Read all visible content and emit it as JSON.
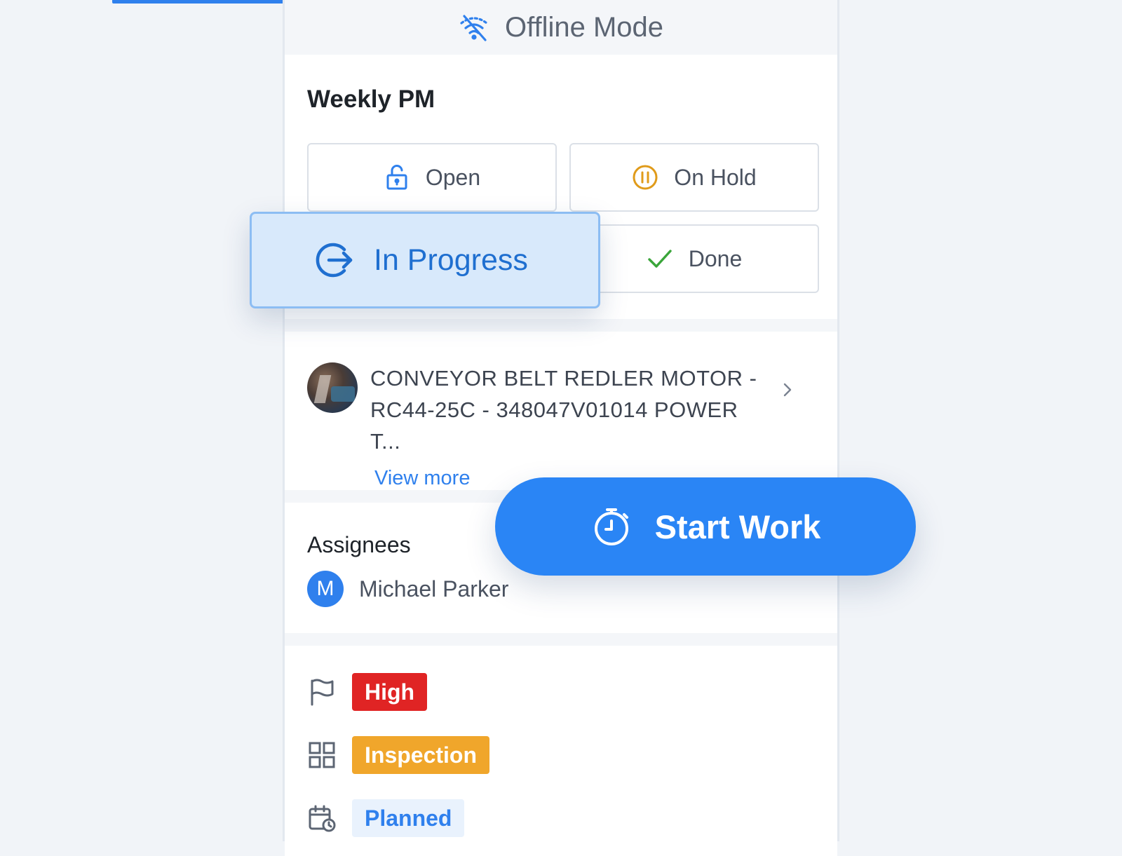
{
  "progress": {
    "fraction": 0.5
  },
  "header": {
    "offline_label": "Offline Mode",
    "icon": "wifi-off-icon"
  },
  "work_order": {
    "title": "Weekly PM",
    "statuses": [
      {
        "label": "Open",
        "icon": "unlock-icon",
        "color": "#2f80ed"
      },
      {
        "label": "On Hold",
        "icon": "pause-circle-icon",
        "color": "#e09b1a"
      },
      {
        "label": "In Progress",
        "icon": "progress-arrow-icon",
        "color": "#1f6fd0",
        "selected": true
      },
      {
        "label": "Done",
        "icon": "checkmark-icon",
        "color": "#3aa53a"
      }
    ]
  },
  "asset": {
    "name_line1": "CONVEYOR BELT REDLER MOTOR -",
    "name_line2": "RC44-25C - 348047V01014 POWER T...",
    "view_more": "View more"
  },
  "assignees": {
    "label": "Assignees",
    "people": [
      {
        "initial": "M",
        "name": "Michael Parker"
      }
    ]
  },
  "tags": {
    "priority": {
      "label": "High",
      "bg": "#e02424",
      "fg": "#ffffff",
      "icon": "flag-icon"
    },
    "category": {
      "label": "Inspection",
      "bg": "#f0a62b",
      "fg": "#ffffff",
      "icon": "grid-icon"
    },
    "type": {
      "label": "Planned",
      "bg": "#e9f2fd",
      "fg": "#2f80ed",
      "icon": "calendar-clock-icon"
    }
  },
  "actions": {
    "start_work": "Start Work",
    "start_icon": "stopwatch-icon"
  },
  "theme": {
    "accent": "#2a85f5"
  }
}
